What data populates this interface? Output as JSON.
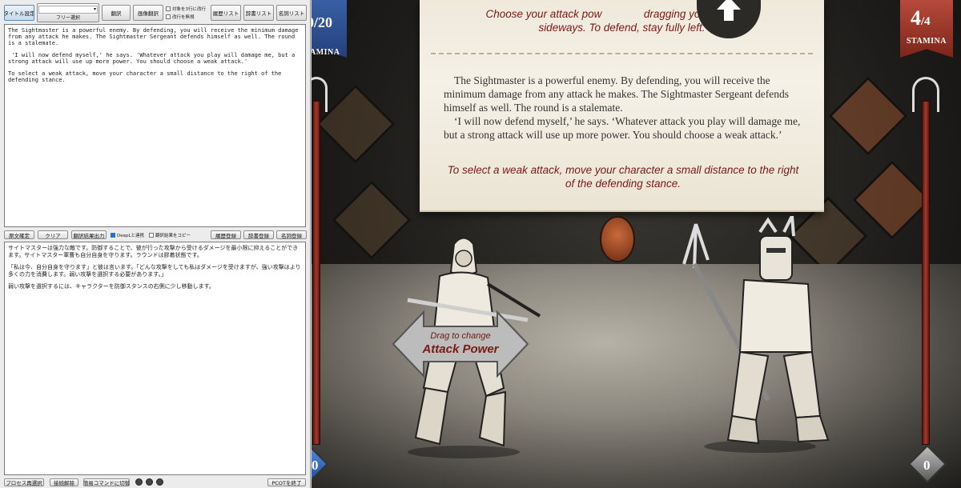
{
  "tool": {
    "top_buttons": [
      "タイトル設定",
      "翻訳",
      "画像翻訳",
      "履歴リスト",
      "辞書リスト",
      "名詞リスト"
    ],
    "dropdown": {
      "value": "",
      "label": "フリー選択"
    },
    "checkboxes": [
      {
        "label": "対象を3行に改行",
        "checked": false
      },
      {
        "label": "改行を無視",
        "checked": false
      }
    ],
    "source_text": [
      "The Sightmaster is a powerful enemy. By defending, you will receive the minimum damage from any attack he makes. The Sightmaster Sergeant defends himself as well. The round is a stalemate.",
      " 'I will now defend myself,' he says. 'Whatever attack you play will damage me, but a strong attack will use up more power. You should choose a weak attack.'",
      "To select a weak attack, move your character a small distance to the right of the defending stance."
    ],
    "mid_buttons": [
      "原文確定",
      "クリア",
      "翻訳結果出力",
      "履歴登録",
      "辞書登録",
      "名詞登録"
    ],
    "mid_checkboxes": [
      {
        "label": "DeepLと連携",
        "checked": true
      },
      {
        "label": "翻訳結果をコピー",
        "checked": false
      }
    ],
    "translation_text": [
      "サイトマスターは強力な敵です。防御することで、彼が行った攻撃から受けるダメージを最小限に抑えることができます。サイトマスター軍曹も自分自身を守ります。ラウンドは膠着状態です。",
      "「私は今、自分自身を守ります」と彼は言います。「どんな攻撃をしても私はダメージを受けますが、強い攻撃はより多くの力を消費します。弱い攻撃を選択する必要があります。」",
      "弱い攻撃を選択するには、キャラクターを防御スタンスの右側に少し移動します。"
    ],
    "bottom_buttons": [
      "プロセス再選択",
      "接続解除",
      "簡易コマンドに切替"
    ],
    "exit_button": "PCOTを終了"
  },
  "game": {
    "hint_top": "Choose your attack power by dragging your character sideways. To defend, stay fully left.",
    "hint_top_visible_line1_a": "Choose your attack pow",
    "hint_top_visible_line1_b": "dragging your character",
    "hint_top_visible_line2": "sideways. To defend, stay fully left.",
    "story": [
      "The Sightmaster is a powerful enemy. By defending, you will receive the minimum damage from any attack he makes. The Sightmaster Sergeant defends himself as well. The round is a stalemate.",
      "‘I will now defend myself,’ he says. ‘Whatever attack you play will damage me, but a strong attack will use up more power. You should choose a weak attack.’"
    ],
    "instruction": "To select a weak attack, move your character a small distance to the right of the defending stance.",
    "player_stamina": "0/20",
    "enemy_stamina_current": "4",
    "enemy_stamina_max": "/4",
    "stamina_label": "STAMINA",
    "player_stamina_label_partial": "AMINA",
    "drag_line1": "Drag to change",
    "drag_line2": "Attack Power",
    "player_power": "0",
    "enemy_power": "0"
  }
}
